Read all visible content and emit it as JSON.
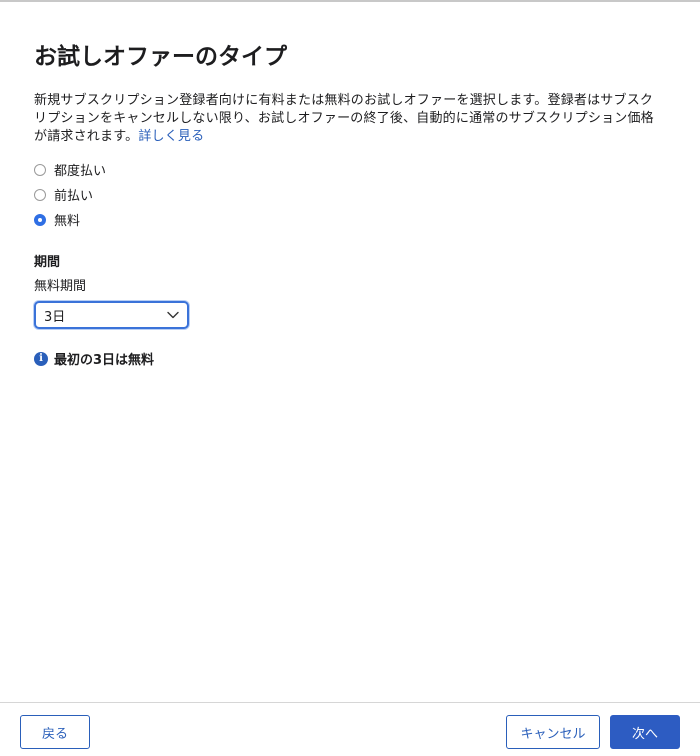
{
  "dialog": {
    "title": "お試しオファーのタイプ",
    "description": "新規サブスクリプション登録者向けに有料または無料のお試しオファーを選択します。登録者はサブスクリプションをキャンセルしない限り、お試しオファーの終了後、自動的に通常のサブスクリプション価格が請求されます。",
    "learn_more": "詳しく見る"
  },
  "offer_types": [
    {
      "label": "都度払い",
      "selected": false
    },
    {
      "label": "前払い",
      "selected": false
    },
    {
      "label": "無料",
      "selected": true
    }
  ],
  "duration": {
    "section_label": "期間",
    "field_label": "無料期間",
    "selected_value": "3日",
    "info_text": "最初の3日は無料"
  },
  "footer": {
    "back_label": "戻る",
    "cancel_label": "キャンセル",
    "next_label": "次へ"
  },
  "colors": {
    "accent": "#2a5fba",
    "primary_button": "#2d5cc2",
    "radio_selected": "#2f6fe4"
  },
  "icons": {
    "chevron": "chevron-down-icon",
    "info": "info-icon"
  }
}
